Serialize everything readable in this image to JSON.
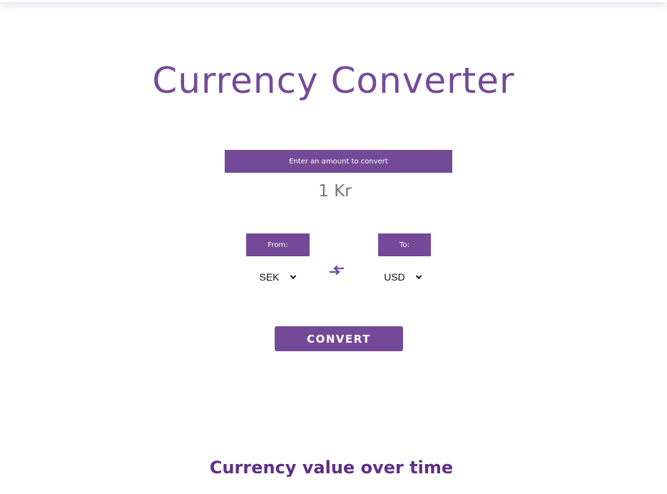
{
  "page": {
    "title": "Currency Converter",
    "section_title": "Currency value over time"
  },
  "amount": {
    "label": "Enter an amount to convert",
    "value": "1 Kr"
  },
  "from": {
    "label": "From:",
    "selected": "SEK"
  },
  "to": {
    "label": "To:",
    "selected": "USD"
  },
  "actions": {
    "convert_label": "CONVERT"
  },
  "icons": {
    "swap": "swap-arrows-icon",
    "dropdown": "chevron-down-icon"
  },
  "colors": {
    "accent": "#744a98",
    "title": "#744a98",
    "section_title": "#5e2f86",
    "amount_text": "#777777"
  }
}
